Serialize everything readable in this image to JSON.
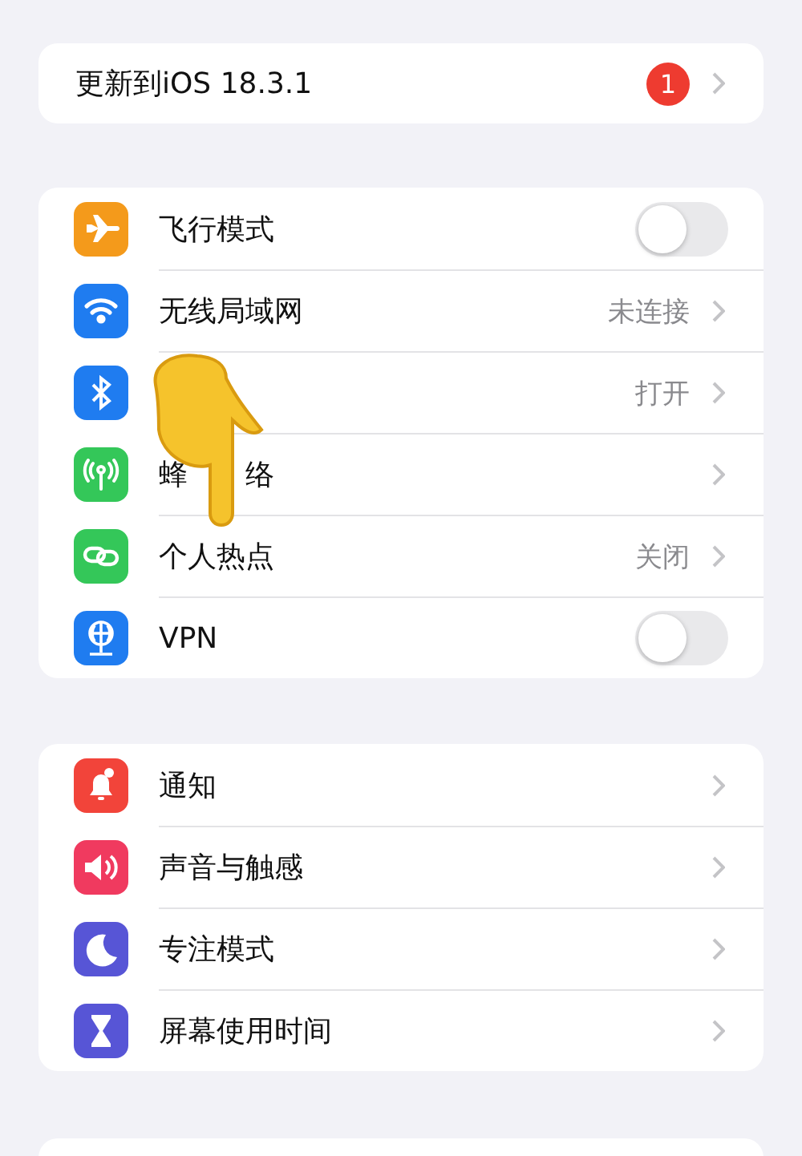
{
  "update": {
    "label": "更新到iOS 18.3.1",
    "badge": "1"
  },
  "groups": [
    {
      "rows": [
        {
          "kind": "toggle",
          "label": "飞行模式",
          "color": "#f49a1b",
          "on": false
        },
        {
          "kind": "link",
          "label": "无线局域网",
          "value": "未连接",
          "color": "#1f7cf0"
        },
        {
          "kind": "link",
          "value": "打开",
          "color": "#1f7cf0"
        },
        {
          "kind": "link",
          "label": "蜂",
          "label_after_hand": "络",
          "color": "#34c759"
        },
        {
          "kind": "link",
          "label": "个人热点",
          "value": "关闭",
          "color": "#34c759"
        },
        {
          "kind": "toggle",
          "label": "VPN",
          "color": "#1f7cf0",
          "on": false
        }
      ]
    },
    {
      "rows": [
        {
          "kind": "link",
          "label": "通知",
          "color": "#f2443a"
        },
        {
          "kind": "link",
          "label": "声音与触感",
          "color": "#f03a5f"
        },
        {
          "kind": "link",
          "label": "专注模式",
          "color": "#5755d6"
        },
        {
          "kind": "link",
          "label": "屏幕使用时间",
          "color": "#5755d6"
        }
      ]
    }
  ]
}
